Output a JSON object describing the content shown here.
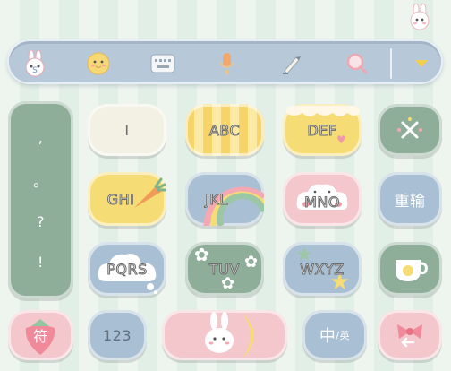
{
  "toolbar": {
    "icons": [
      "rabbit-logo-icon",
      "emoji-face-icon",
      "keyboard-icon",
      "microphone-icon",
      "pen-icon",
      "search-icon",
      "collapse-arrow-icon"
    ]
  },
  "symbols": [
    ",",
    "。",
    "?",
    "!"
  ],
  "keys": {
    "k1": "I",
    "k2": "ABC",
    "k3": "DEF",
    "k4": "GHI",
    "k5": "JKL",
    "k6": "MNO",
    "k7": "PQRS",
    "k8": "TUV",
    "k9": "WXYZ"
  },
  "side": {
    "retype": "重输"
  },
  "bottom": {
    "symbol": "符",
    "num": "123",
    "lang_main": "中",
    "lang_sub": "/英"
  },
  "colors": {
    "toolbar": "#b7c8d9",
    "green": "#8fae9a",
    "blue": "#a9bfd3",
    "yellow": "#f6dc74",
    "pink": "#f3c7cc",
    "cream": "#f3f0e4"
  }
}
